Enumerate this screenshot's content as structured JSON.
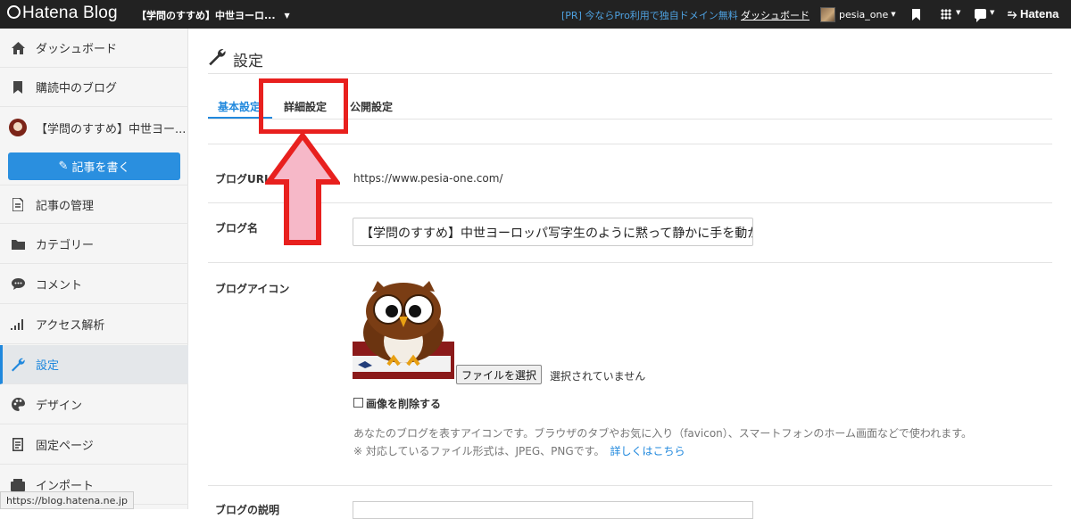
{
  "topbar": {
    "logo": "Hatena Blog",
    "blog_selector": "【学問のすすめ】中世ヨーロ...",
    "pr_link": "[PR] 今ならPro利用で独自ドメイン無料",
    "dashboard_link": "ダッシュボード",
    "username": "pesia_one",
    "hatena_label": "Hatena"
  },
  "sidebar": {
    "items": [
      {
        "label": "ダッシュボード",
        "icon": "home-icon"
      },
      {
        "label": "購読中のブログ",
        "icon": "bookmark-icon"
      },
      {
        "label": "【学問のすすめ】中世ヨー...",
        "icon": "blog-avatar-icon"
      },
      {
        "label": "記事の管理",
        "icon": "document-icon"
      },
      {
        "label": "カテゴリー",
        "icon": "folder-icon"
      },
      {
        "label": "コメント",
        "icon": "comment-icon"
      },
      {
        "label": "アクセス解析",
        "icon": "signal-icon"
      },
      {
        "label": "設定",
        "icon": "wrench-icon"
      },
      {
        "label": "デザイン",
        "icon": "palette-icon"
      },
      {
        "label": "固定ページ",
        "icon": "page-icon"
      },
      {
        "label": "インポート",
        "icon": "import-icon"
      }
    ],
    "write_button": "記事を書く"
  },
  "status_url": "https://blog.hatena.ne.jp",
  "main": {
    "title": "設定",
    "tabs": [
      {
        "label": "基本設定",
        "active": true
      },
      {
        "label": "詳細設定",
        "active": false
      },
      {
        "label": "公開設定",
        "active": false
      }
    ],
    "fields": {
      "url_label": "ブログURL",
      "url_value": "https://www.pesia-one.com/",
      "name_label": "ブログ名",
      "name_value": "【学問のすすめ】中世ヨーロッパ写字生のように黙って静かに手を動か",
      "icon_label": "ブログアイコン",
      "file_button": "ファイルを選択",
      "file_status": "選択されていません",
      "delete_checkbox": "画像を削除する",
      "help_text_1": "あなたのブログを表すアイコンです。ブラウザのタブやお気に入り（favicon）、スマートフォンのホーム画面などで使われます。",
      "help_text_2": "※ 対応しているファイル形式は、JPEG、PNGです。",
      "help_link": "詳しくはこちら",
      "desc_label": "ブログの説明"
    }
  },
  "colors": {
    "accent": "#2088dd",
    "annotation": "#e8201e",
    "arrow_fill": "#f6b8c8"
  }
}
